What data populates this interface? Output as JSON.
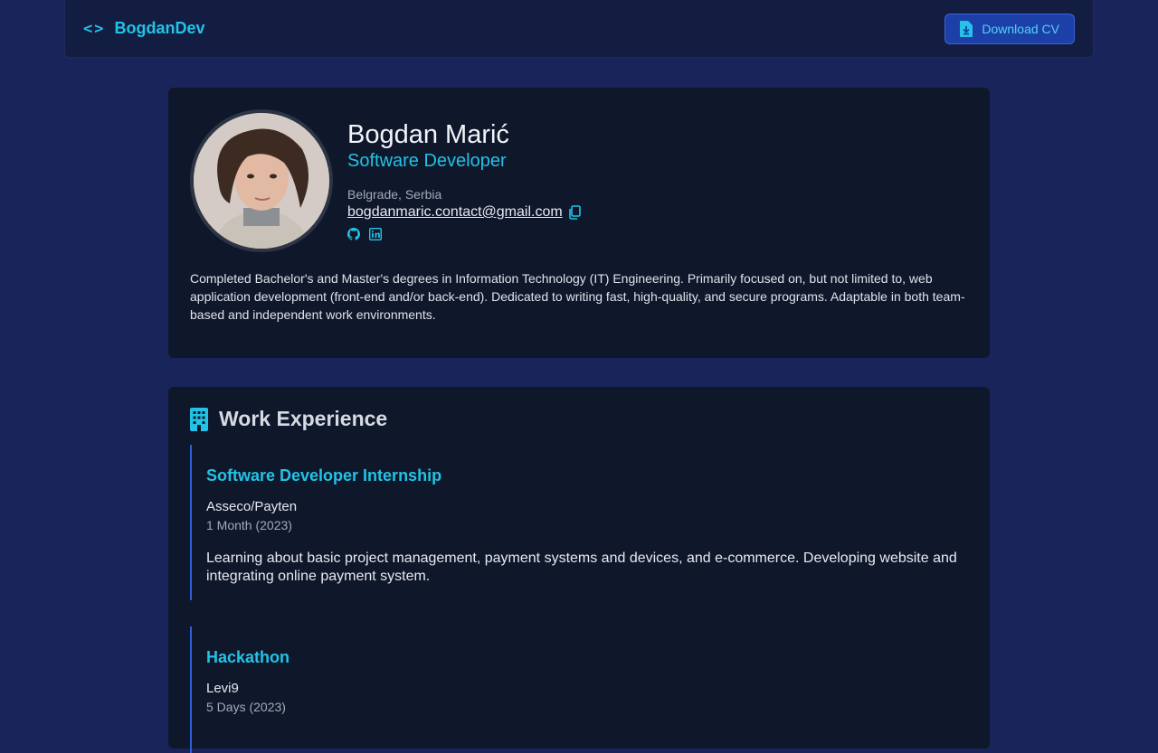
{
  "nav": {
    "brand_icon": "code-brackets-icon",
    "brand": "BogdanDev",
    "download_label": "Download CV"
  },
  "profile": {
    "name": "Bogdan Marić",
    "title": "Software Developer",
    "location": "Belgrade, Serbia",
    "email": "bogdanmaric.contact@gmail.com",
    "socials": [
      "github-icon",
      "linkedin-icon"
    ],
    "bio": "Completed Bachelor's and Master's degrees in Information Technology (IT) Engineering. Primarily focused on, but not limited to, web application development (front-end and/or back-end). Dedicated to writing fast, high-quality, and secure programs. Adaptable in both team-based and independent work environments."
  },
  "work": {
    "heading": "Work Experience",
    "jobs": [
      {
        "title": "Software Developer Internship",
        "company": "Asseco/Payten",
        "duration": "1 Month (2023)",
        "description": "Learning about basic project management, payment systems and devices, and e-commerce. Developing website and integrating online payment system."
      },
      {
        "title": "Hackathon",
        "company": "Levi9",
        "duration": "5 Days (2023)"
      }
    ]
  },
  "colors": {
    "page_bg": "#18245a",
    "card_bg": "#0f172b",
    "accent": "#22c3e6",
    "button_bg": "#1d3fa8",
    "timeline": "#2f5fd8"
  }
}
